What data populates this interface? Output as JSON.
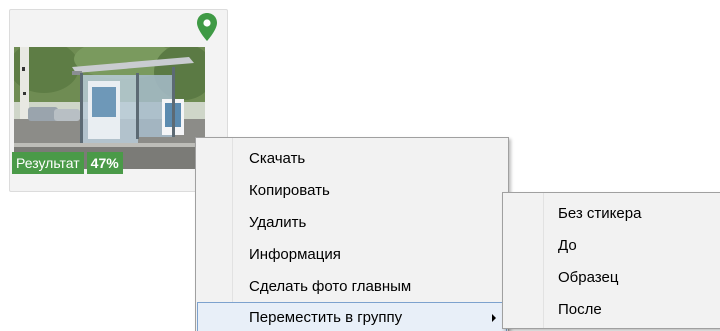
{
  "card": {
    "badge": {
      "result_label": "Результат",
      "percent": "47%"
    },
    "pin_icon": "map-pin-icon",
    "colors": {
      "badge_bg": "#4a9a48",
      "pin": "#3f9a45"
    }
  },
  "context_menu": {
    "items": [
      {
        "label": "Скачать"
      },
      {
        "label": "Копировать"
      },
      {
        "label": "Удалить"
      },
      {
        "label": "Информация"
      },
      {
        "label": "Сделать фото главным"
      },
      {
        "label": "Переместить в группу",
        "has_submenu": true,
        "highlighted": true
      }
    ]
  },
  "submenu": {
    "items": [
      {
        "label": "Без стикера"
      },
      {
        "label": "До"
      },
      {
        "label": "Образец"
      },
      {
        "label": "После"
      }
    ]
  }
}
